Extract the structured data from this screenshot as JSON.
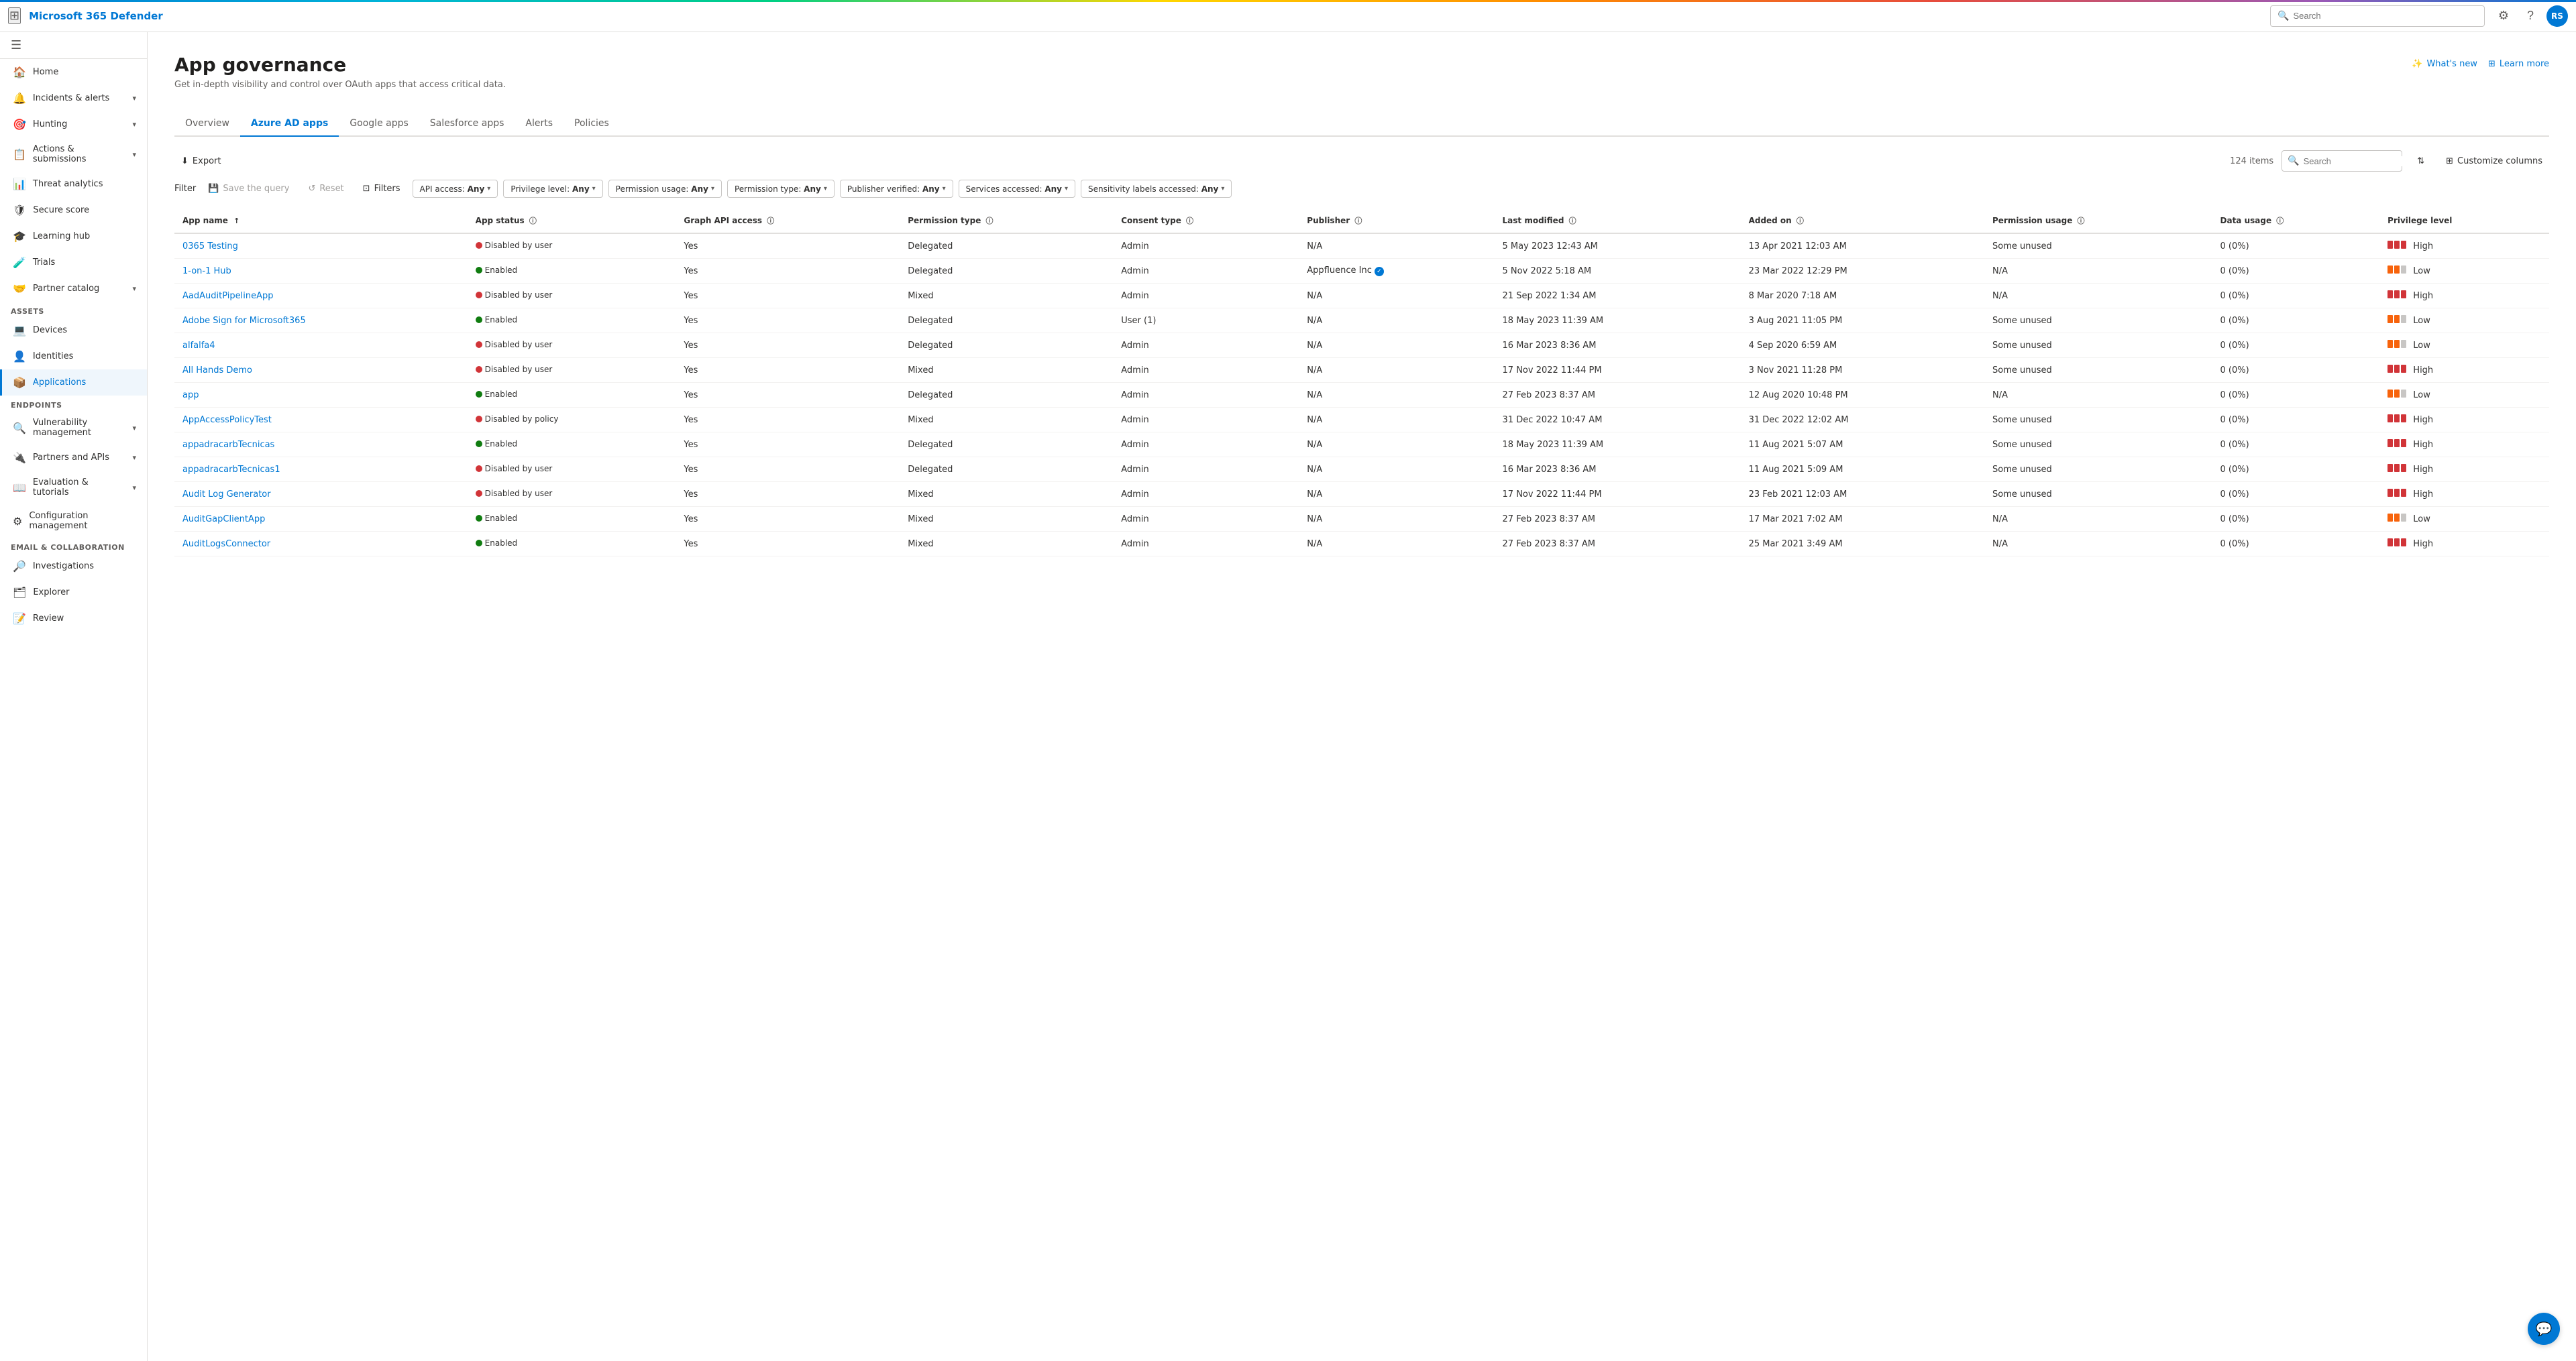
{
  "topbar": {
    "brand": "Microsoft 365 Defender",
    "search_placeholder": "Search",
    "avatar_initials": "RS"
  },
  "sidebar": {
    "collapse_label": "Collapse",
    "items": [
      {
        "id": "home",
        "label": "Home",
        "icon": "🏠",
        "expandable": false
      },
      {
        "id": "incidents",
        "label": "Incidents & alerts",
        "icon": "🔔",
        "expandable": true
      },
      {
        "id": "hunting",
        "label": "Hunting",
        "icon": "🎯",
        "expandable": true
      },
      {
        "id": "actions",
        "label": "Actions & submissions",
        "icon": "📋",
        "expandable": true
      },
      {
        "id": "threat",
        "label": "Threat analytics",
        "icon": "📊",
        "expandable": false
      },
      {
        "id": "secure",
        "label": "Secure score",
        "icon": "🛡",
        "expandable": false
      },
      {
        "id": "learning",
        "label": "Learning hub",
        "icon": "🎓",
        "expandable": false
      },
      {
        "id": "trials",
        "label": "Trials",
        "icon": "🧪",
        "expandable": false
      },
      {
        "id": "partner",
        "label": "Partner catalog",
        "icon": "🤝",
        "expandable": true
      },
      {
        "id": "assets_header",
        "label": "Assets",
        "section": true
      },
      {
        "id": "devices",
        "label": "Devices",
        "icon": "💻",
        "expandable": false
      },
      {
        "id": "identities",
        "label": "Identities",
        "icon": "👤",
        "expandable": false
      },
      {
        "id": "applications",
        "label": "Applications",
        "icon": "📦",
        "expandable": false,
        "active": true
      },
      {
        "id": "endpoints_header",
        "label": "Endpoints",
        "section": true
      },
      {
        "id": "vulnerability",
        "label": "Vulnerability management",
        "icon": "🔍",
        "expandable": true
      },
      {
        "id": "partners_apis",
        "label": "Partners and APIs",
        "icon": "🔌",
        "expandable": true
      },
      {
        "id": "evaluation",
        "label": "Evaluation & tutorials",
        "icon": "📖",
        "expandable": true
      },
      {
        "id": "config",
        "label": "Configuration management",
        "icon": "⚙",
        "expandable": false
      },
      {
        "id": "email_collab_header",
        "label": "Email & collaboration",
        "section": true
      },
      {
        "id": "investigations",
        "label": "Investigations",
        "icon": "🔎",
        "expandable": false
      },
      {
        "id": "explorer",
        "label": "Explorer",
        "icon": "🗂",
        "expandable": false
      },
      {
        "id": "review",
        "label": "Review",
        "icon": "📝",
        "expandable": false
      }
    ]
  },
  "page": {
    "title": "App governance",
    "subtitle": "Get in-depth visibility and control over OAuth apps that access critical data.",
    "whats_new_label": "What's new",
    "learn_more_label": "Learn more"
  },
  "tabs": [
    {
      "id": "overview",
      "label": "Overview"
    },
    {
      "id": "azure_ad",
      "label": "Azure AD apps",
      "active": true
    },
    {
      "id": "google",
      "label": "Google apps"
    },
    {
      "id": "salesforce",
      "label": "Salesforce apps"
    },
    {
      "id": "alerts",
      "label": "Alerts"
    },
    {
      "id": "policies",
      "label": "Policies"
    }
  ],
  "toolbar": {
    "export_label": "Export",
    "filter_label": "Filter",
    "save_query_label": "Save the query",
    "reset_label": "Reset",
    "filters_label": "Filters",
    "items_count": "124 items",
    "search_placeholder": "Search",
    "customize_columns_label": "Customize columns"
  },
  "filters": [
    {
      "label": "API access:",
      "value": "Any"
    },
    {
      "label": "Privilege level:",
      "value": "Any"
    },
    {
      "label": "Permission usage:",
      "value": "Any"
    },
    {
      "label": "Permission type:",
      "value": "Any"
    },
    {
      "label": "Publisher verified:",
      "value": "Any"
    },
    {
      "label": "Services accessed:",
      "value": "Any"
    },
    {
      "label": "Sensitivity labels accessed:",
      "value": "Any"
    }
  ],
  "table": {
    "columns": [
      {
        "id": "app_name",
        "label": "App name",
        "sortable": true,
        "sort_dir": "asc"
      },
      {
        "id": "app_status",
        "label": "App status",
        "info": true
      },
      {
        "id": "graph_api",
        "label": "Graph API access",
        "info": true
      },
      {
        "id": "permission_type",
        "label": "Permission type",
        "info": true
      },
      {
        "id": "consent_type",
        "label": "Consent type",
        "info": true
      },
      {
        "id": "publisher",
        "label": "Publisher",
        "info": true
      },
      {
        "id": "last_modified",
        "label": "Last modified",
        "info": true
      },
      {
        "id": "added_on",
        "label": "Added on",
        "info": true
      },
      {
        "id": "permission_usage",
        "label": "Permission usage",
        "info": true
      },
      {
        "id": "data_usage",
        "label": "Data usage",
        "info": true
      },
      {
        "id": "privilege_level",
        "label": "Privilege level"
      }
    ],
    "rows": [
      {
        "app_name": "0365 Testing",
        "app_status": "Disabled by user",
        "status_type": "disabled",
        "graph_api": "Yes",
        "permission_type": "Delegated",
        "consent_type": "Admin",
        "publisher": "N/A",
        "verified": false,
        "last_modified": "5 May 2023 12:43 AM",
        "added_on": "13 Apr 2021 12:03 AM",
        "permission_usage": "Some unused",
        "data_usage": "0 (0%)",
        "privilege_level": "High",
        "privilege_type": "high"
      },
      {
        "app_name": "1-on-1 Hub",
        "app_status": "Enabled",
        "status_type": "enabled",
        "graph_api": "Yes",
        "permission_type": "Delegated",
        "consent_type": "Admin",
        "publisher": "Appfluence Inc",
        "verified": true,
        "last_modified": "5 Nov 2022 5:18 AM",
        "added_on": "23 Mar 2022 12:29 PM",
        "permission_usage": "N/A",
        "data_usage": "0 (0%)",
        "privilege_level": "Low",
        "privilege_type": "low"
      },
      {
        "app_name": "AadAuditPipelineApp",
        "app_status": "Disabled by user",
        "status_type": "disabled",
        "graph_api": "Yes",
        "permission_type": "Mixed",
        "consent_type": "Admin",
        "publisher": "N/A",
        "verified": false,
        "last_modified": "21 Sep 2022 1:34 AM",
        "added_on": "8 Mar 2020 7:18 AM",
        "permission_usage": "N/A",
        "data_usage": "0 (0%)",
        "privilege_level": "High",
        "privilege_type": "high"
      },
      {
        "app_name": "Adobe Sign for Microsoft365",
        "app_status": "Enabled",
        "status_type": "enabled",
        "graph_api": "Yes",
        "permission_type": "Delegated",
        "consent_type": "User (1)",
        "publisher": "N/A",
        "verified": false,
        "last_modified": "18 May 2023 11:39 AM",
        "added_on": "3 Aug 2021 11:05 PM",
        "permission_usage": "Some unused",
        "data_usage": "0 (0%)",
        "privilege_level": "Low",
        "privilege_type": "low"
      },
      {
        "app_name": "alfalfa4",
        "app_status": "Disabled by user",
        "status_type": "disabled",
        "graph_api": "Yes",
        "permission_type": "Delegated",
        "consent_type": "Admin",
        "publisher": "N/A",
        "verified": false,
        "last_modified": "16 Mar 2023 8:36 AM",
        "added_on": "4 Sep 2020 6:59 AM",
        "permission_usage": "Some unused",
        "data_usage": "0 (0%)",
        "privilege_level": "Low",
        "privilege_type": "low"
      },
      {
        "app_name": "All Hands Demo",
        "app_status": "Disabled by user",
        "status_type": "disabled",
        "graph_api": "Yes",
        "permission_type": "Mixed",
        "consent_type": "Admin",
        "publisher": "N/A",
        "verified": false,
        "last_modified": "17 Nov 2022 11:44 PM",
        "added_on": "3 Nov 2021 11:28 PM",
        "permission_usage": "Some unused",
        "data_usage": "0 (0%)",
        "privilege_level": "High",
        "privilege_type": "high"
      },
      {
        "app_name": "app",
        "app_status": "Enabled",
        "status_type": "enabled",
        "graph_api": "Yes",
        "permission_type": "Delegated",
        "consent_type": "Admin",
        "publisher": "N/A",
        "verified": false,
        "last_modified": "27 Feb 2023 8:37 AM",
        "added_on": "12 Aug 2020 10:48 PM",
        "permission_usage": "N/A",
        "data_usage": "0 (0%)",
        "privilege_level": "Low",
        "privilege_type": "low"
      },
      {
        "app_name": "AppAccessPolicyTest",
        "app_status": "Disabled by policy",
        "status_type": "disabled",
        "graph_api": "Yes",
        "permission_type": "Mixed",
        "consent_type": "Admin",
        "publisher": "N/A",
        "verified": false,
        "last_modified": "31 Dec 2022 10:47 AM",
        "added_on": "31 Dec 2022 12:02 AM",
        "permission_usage": "Some unused",
        "data_usage": "0 (0%)",
        "privilege_level": "High",
        "privilege_type": "high"
      },
      {
        "app_name": "appadracarbTecnicas",
        "app_status": "Enabled",
        "status_type": "enabled",
        "graph_api": "Yes",
        "permission_type": "Delegated",
        "consent_type": "Admin",
        "publisher": "N/A",
        "verified": false,
        "last_modified": "18 May 2023 11:39 AM",
        "added_on": "11 Aug 2021 5:07 AM",
        "permission_usage": "Some unused",
        "data_usage": "0 (0%)",
        "privilege_level": "High",
        "privilege_type": "high"
      },
      {
        "app_name": "appadracarbTecnicas1",
        "app_status": "Disabled by user",
        "status_type": "disabled",
        "graph_api": "Yes",
        "permission_type": "Delegated",
        "consent_type": "Admin",
        "publisher": "N/A",
        "verified": false,
        "last_modified": "16 Mar 2023 8:36 AM",
        "added_on": "11 Aug 2021 5:09 AM",
        "permission_usage": "Some unused",
        "data_usage": "0 (0%)",
        "privilege_level": "High",
        "privilege_type": "high"
      },
      {
        "app_name": "Audit Log Generator",
        "app_status": "Disabled by user",
        "status_type": "disabled",
        "graph_api": "Yes",
        "permission_type": "Mixed",
        "consent_type": "Admin",
        "publisher": "N/A",
        "verified": false,
        "last_modified": "17 Nov 2022 11:44 PM",
        "added_on": "23 Feb 2021 12:03 AM",
        "permission_usage": "Some unused",
        "data_usage": "0 (0%)",
        "privilege_level": "High",
        "privilege_type": "high"
      },
      {
        "app_name": "AuditGapClientApp",
        "app_status": "Enabled",
        "status_type": "enabled",
        "graph_api": "Yes",
        "permission_type": "Mixed",
        "consent_type": "Admin",
        "publisher": "N/A",
        "verified": false,
        "last_modified": "27 Feb 2023 8:37 AM",
        "added_on": "17 Mar 2021 7:02 AM",
        "permission_usage": "N/A",
        "data_usage": "0 (0%)",
        "privilege_level": "Low",
        "privilege_type": "low"
      },
      {
        "app_name": "AuditLogsConnector",
        "app_status": "Enabled",
        "status_type": "enabled",
        "graph_api": "Yes",
        "permission_type": "Mixed",
        "consent_type": "Admin",
        "publisher": "N/A",
        "verified": false,
        "last_modified": "27 Feb 2023 8:37 AM",
        "added_on": "25 Mar 2021 3:49 AM",
        "permission_usage": "N/A",
        "data_usage": "0 (0%)",
        "privilege_level": "High",
        "privilege_type": "high"
      }
    ]
  },
  "chat_btn_label": "💬"
}
